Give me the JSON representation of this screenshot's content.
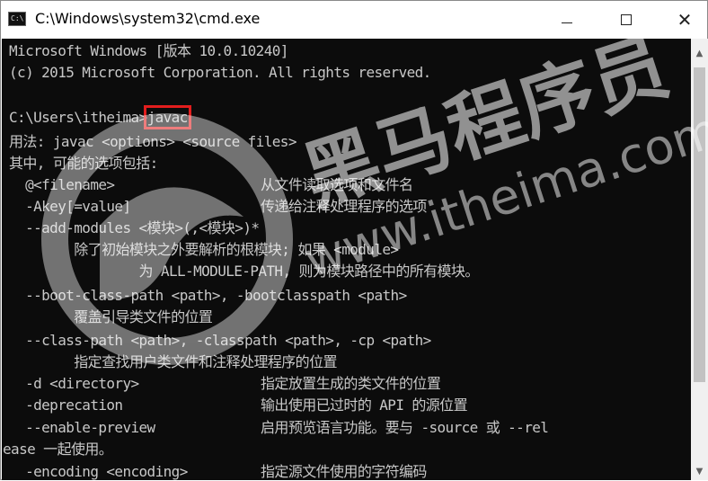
{
  "window": {
    "title": "C:\\Windows\\system32\\cmd.exe",
    "icon": "cmd-console-icon",
    "controls": {
      "minimize": "minimize-icon",
      "maximize": "maximize-icon",
      "close_glyph": "✕"
    }
  },
  "console": {
    "lines": [
      "Microsoft Windows [版本 10.0.10240]",
      "(c) 2015 Microsoft Corporation. All rights reserved.",
      "",
      "C:\\Users\\itheima>",
      "用法: javac <options> <source files>",
      "其中, 可能的选项包括:",
      "  @<filename>                  从文件读取选项和文件名",
      "  -Akey[=value]                传递给注释处理程序的选项",
      "  --add-modules <模块>(,<模块>)*",
      "        除了初始模块之外要解析的根模块; 如果 <module>",
      "                为 ALL-MODULE-PATH, 则为模块路径中的所有模块。",
      "  --boot-class-path <path>, -bootclasspath <path>",
      "        覆盖引导类文件的位置",
      "  --class-path <path>, -classpath <path>, -cp <path>",
      "        指定查找用户类文件和注释处理程序的位置",
      "  -d <directory>               指定放置生成的类文件的位置",
      "  -deprecation                 输出使用已过时的 API 的源位置",
      "  --enable-preview             启用预览语言功能。要与 -source 或 --rel",
      "ease 一起使用。",
      "  -encoding <encoding>         指定源文件使用的字符编码"
    ],
    "typed_command": "javac",
    "text_color": "#c8c8c8",
    "background": "#0c0c0c",
    "highlight_color": "#e21d1d"
  },
  "watermark": {
    "brand": "黑马程序员",
    "url": "www.itheima.com"
  },
  "scrollbar": {
    "up_glyph": "▲",
    "down_glyph": "▼"
  }
}
